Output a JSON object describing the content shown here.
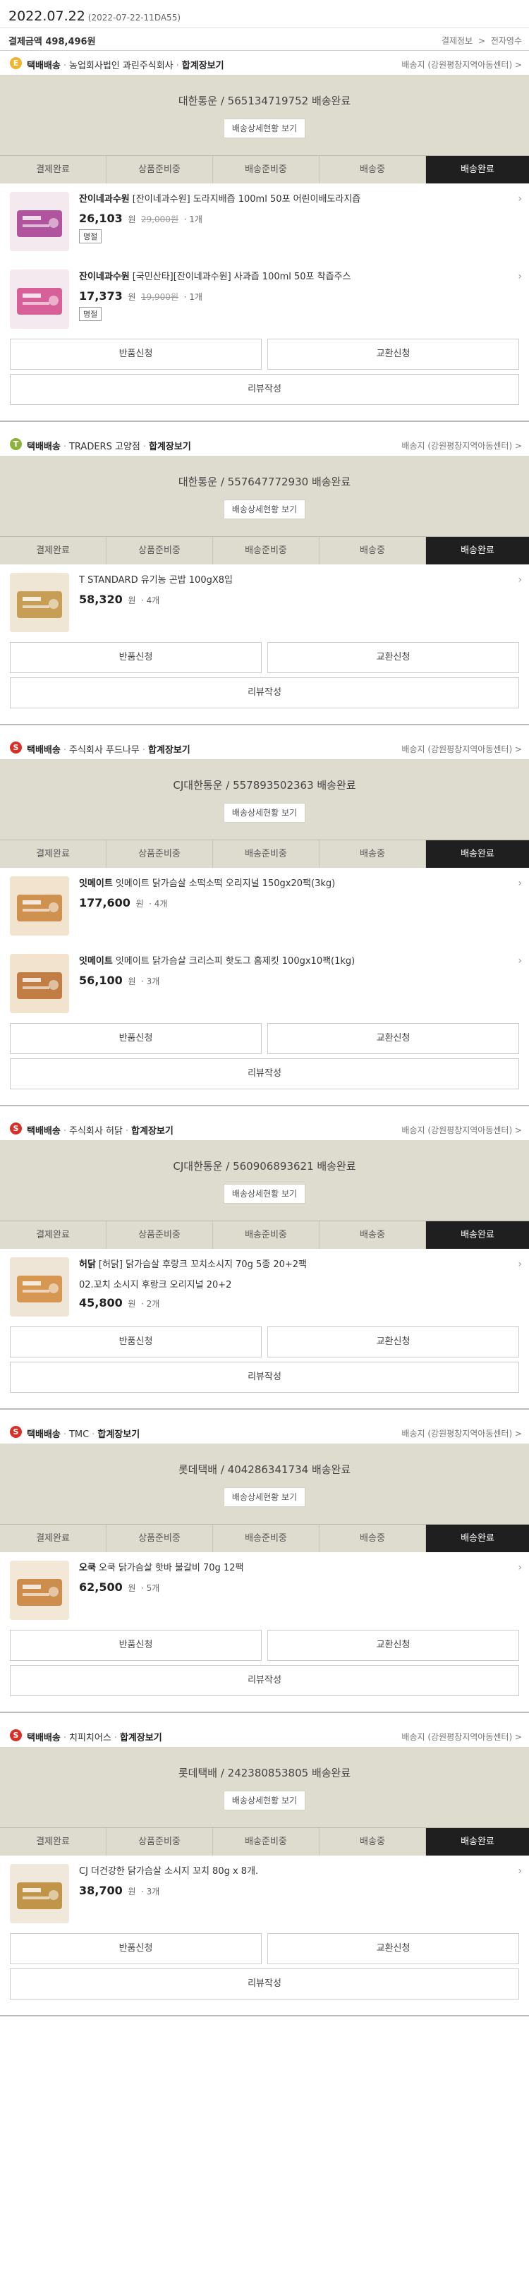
{
  "order": {
    "date": "2022.07.22",
    "number": "(2022-07-22-11DA55)",
    "pay_label": "결제금액",
    "pay_amount": "498,496원",
    "links": [
      "결제정보",
      ">",
      "전자영수"
    ]
  },
  "track_button_label": "배송상세현황 보기",
  "steps": [
    "결제완료",
    "상품준비중",
    "배송준비중",
    "배송중",
    "배송완료"
  ],
  "action_labels": {
    "return": "반품신청",
    "exchange": "교환신청",
    "review": "리뷰작성"
  },
  "shipments": [
    {
      "badge": "E",
      "badge_color": "#f1b22d",
      "method": "택배배송",
      "seller": "농업회사법인 과린주식회사",
      "bundle": "합계장보기",
      "dest": "배송지 (강원평창지역아동센터) >",
      "carrier": "대한통운 / 565134719752 배송완료",
      "items": [
        {
          "brand": "잔이네과수원",
          "name": "[잔이네과수원] 도라지배즙 100ml 50포 어린이배도라지즙",
          "price": "26,103",
          "unit": "원",
          "orig": "29,000원",
          "qty": "· 1개",
          "tag": "명절"
        },
        {
          "brand": "잔이네과수원",
          "name": "[국민산타][잔이네과수원] 사과즙 100ml 50포 착즙주스",
          "price": "17,373",
          "unit": "원",
          "orig": "19,900원",
          "qty": "· 1개",
          "tag": "명절"
        }
      ]
    },
    {
      "badge": "T",
      "badge_color": "#8bb33b",
      "method": "택배배송",
      "seller": "TRADERS 고양점",
      "bundle": "합계장보기",
      "dest": "배송지 (강원평창지역아동센터) >",
      "carrier": "대한통운 / 557647772930 배송완료",
      "items": [
        {
          "brand": "",
          "name": "T STANDARD 유기농 곤밥 100gX8입",
          "price": "58,320",
          "unit": "원",
          "orig": "",
          "qty": "· 4개",
          "tag": ""
        }
      ]
    },
    {
      "badge": "S",
      "badge_color": "#d93025",
      "method": "택배배송",
      "seller": "주식회사 푸드나무",
      "bundle": "합계장보기",
      "dest": "배송지 (강원평창지역아동센터) >",
      "carrier": "CJ대한통운 / 557893502363 배송완료",
      "items": [
        {
          "brand": "잇메이트",
          "name": "잇메이트 닭가슴살 소떡소떡 오리지널 150gx20팩(3kg)",
          "price": "177,600",
          "unit": "원",
          "orig": "",
          "qty": "· 4개",
          "tag": ""
        },
        {
          "brand": "잇메이트",
          "name": "잇메이트 닭가슴살 크리스피 핫도그 홈제킷 100gx10팩(1kg)",
          "price": "56,100",
          "unit": "원",
          "orig": "",
          "qty": "· 3개",
          "tag": ""
        }
      ]
    },
    {
      "badge": "S",
      "badge_color": "#d93025",
      "method": "택배배송",
      "seller": "주식회사 허닭",
      "bundle": "합계장보기",
      "dest": "배송지 (강원평창지역아동센터) >",
      "carrier": "CJ대한통운 / 560906893621 배송완료",
      "items": [
        {
          "brand": "허닭",
          "name": "[허닭] 닭가슴살 후랑크 꼬치소시지 70g 5종 20+2팩",
          "sub": "02.꼬치 소시지 후랑크 오리지널 20+2",
          "price": "45,800",
          "unit": "원",
          "orig": "",
          "qty": "· 2개",
          "tag": ""
        }
      ]
    },
    {
      "badge": "S",
      "badge_color": "#d93025",
      "method": "택배배송",
      "seller": "TMC",
      "bundle": "합계장보기",
      "dest": "배송지 (강원평창지역아동센터) >",
      "carrier": "롯데택배 / 404286341734 배송완료",
      "items": [
        {
          "brand": "오쿡",
          "name": "오쿡 닭가슴살 핫바 불갈비 70g 12팩",
          "price": "62,500",
          "unit": "원",
          "orig": "",
          "qty": "· 5개",
          "tag": ""
        }
      ]
    },
    {
      "badge": "S",
      "badge_color": "#d93025",
      "method": "택배배송",
      "seller": "치피치어스",
      "bundle": "합계장보기",
      "dest": "배송지 (강원평창지역아동센터) >",
      "carrier": "롯데택배 / 242380853805 배송완료",
      "items": [
        {
          "brand": "",
          "name": "CJ 더건강한 닭가슴살 소시지 꼬치 80g x 8개.",
          "price": "38,700",
          "unit": "원",
          "orig": "",
          "qty": "· 3개",
          "tag": ""
        }
      ]
    }
  ]
}
